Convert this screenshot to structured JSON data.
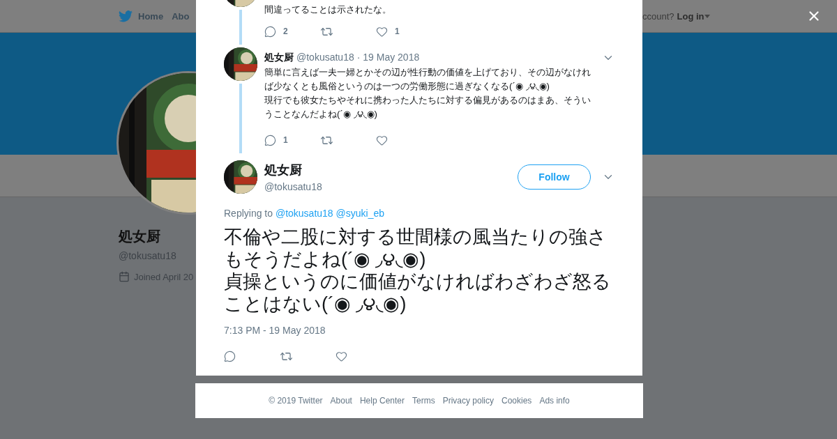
{
  "nav": {
    "items": [
      {
        "label": "Home"
      },
      {
        "label": "Abo"
      }
    ],
    "login_prompt": "ccount?",
    "login": "Log in"
  },
  "profile": {
    "name": "処女厨",
    "handle": "@tokusatu18",
    "joined": "Joined April 20"
  },
  "thread": [
    {
      "paragraphs": [
        "間違ってることは示されたな。"
      ],
      "replies": "2",
      "likes": "1"
    },
    {
      "name": "処女厨",
      "handle": "@tokusatu18",
      "date": "· 19 May 2018",
      "paragraphs": [
        "簡単に言えば一夫一婦とかその辺が性行動の価値を上げており、その辺がなければ少なくとも風俗というのは一つの労働形態に過ぎなくなる(´◉ ◞౪◟◉)",
        "現行でも彼女たちやそれに携わった人たちに対する偏見があるのはまあ、そういうことなんだよね(´◉ ◞౪◟◉)"
      ],
      "replies": "1"
    }
  ],
  "tweet": {
    "name": "処女厨",
    "handle": "@tokusatu18",
    "follow": "Follow",
    "replying_label": "Replying to",
    "replying_to": [
      "@tokusatu18",
      "@syuki_eb"
    ],
    "paragraphs": [
      "不倫や二股に対する世間様の風当たりの強さもそうだよね(´◉ ◞౪◟◉)",
      "貞操というのに価値がなければわざわざ怒ることはない(´◉ ◞౪◟◉)"
    ],
    "time": "7:13 PM - 19 May 2018"
  },
  "footer": [
    "© 2019 Twitter",
    "About",
    "Help Center",
    "Terms",
    "Privacy policy",
    "Cookies",
    "Ads info"
  ]
}
